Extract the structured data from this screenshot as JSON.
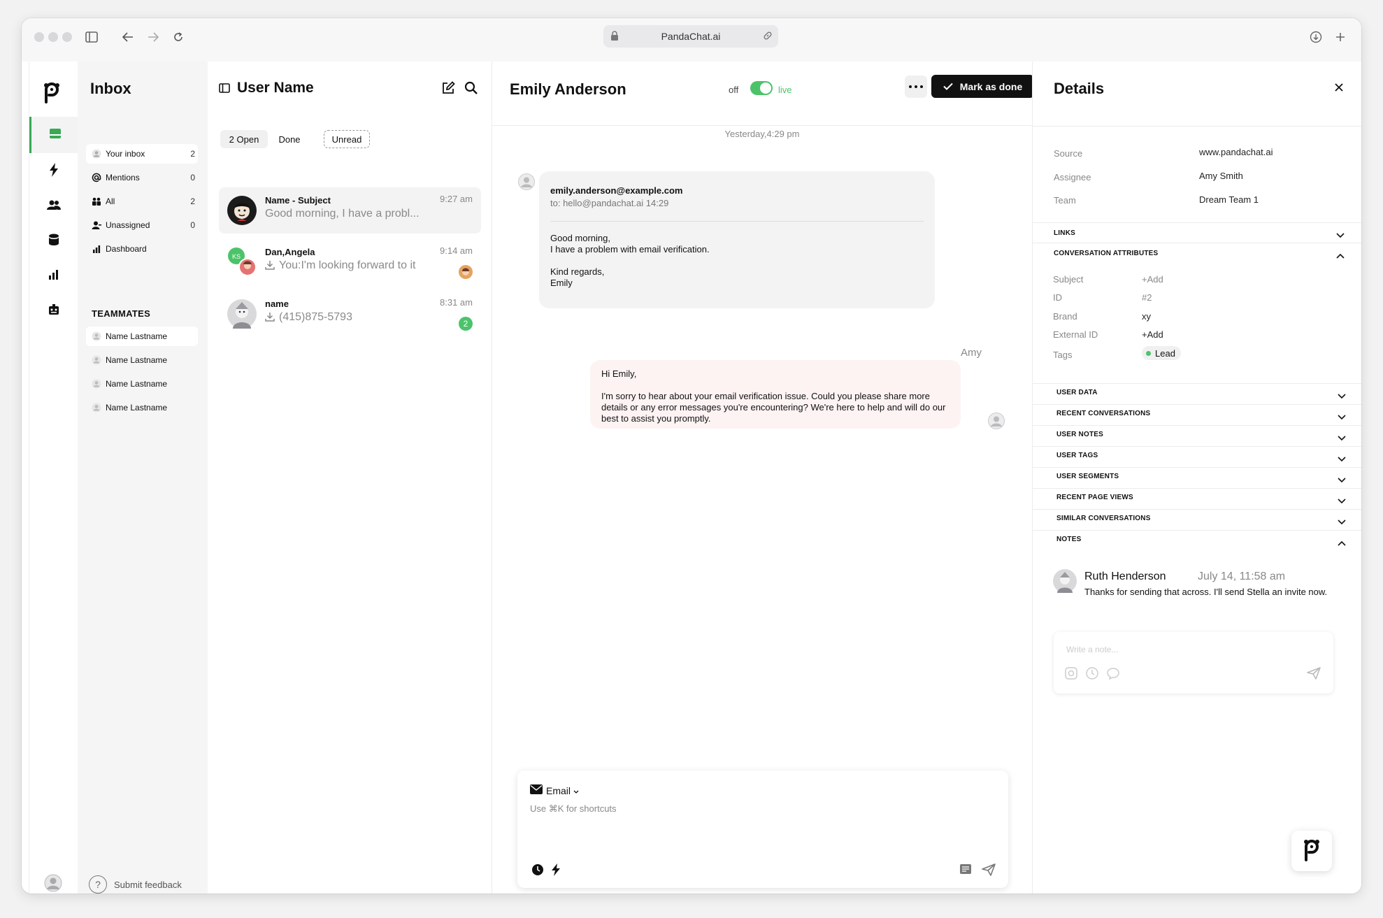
{
  "browser": {
    "url": "PandaChat.ai"
  },
  "sidebar_nav": {
    "title": "Inbox",
    "items": [
      {
        "label": "Your inbox",
        "count": "2",
        "icon": "person-icon"
      },
      {
        "label": "Mentions",
        "count": "0",
        "icon": "at-icon"
      },
      {
        "label": "All",
        "count": "2",
        "icon": "group-icon"
      },
      {
        "label": "Unassigned",
        "count": "0",
        "icon": "unassigned-icon"
      },
      {
        "label": "Dashboard",
        "count": "",
        "icon": "bar-chart-icon"
      }
    ],
    "teammates_heading": "TEAMMATES",
    "teammates": [
      "Name Lastname",
      "Name Lastname",
      "Name Lastname",
      "Name Lastname"
    ],
    "feedback": "Submit feedback"
  },
  "conversation_list": {
    "title": "User Name",
    "filters": {
      "open": "2 Open",
      "done": "Done",
      "unread": "Unread"
    },
    "items": [
      {
        "name": "Name - Subject",
        "preview": "Good morning, I have a probl...",
        "time": "9:27 am"
      },
      {
        "name": "Dan,Angela",
        "preview": "You:I'm looking forward to it",
        "time": "9:14 am",
        "initials": "KS"
      },
      {
        "name": "name",
        "preview": "(415)875-5793",
        "time": "8:31 am",
        "badge": "2"
      }
    ]
  },
  "chat": {
    "contact_name": "Emily Anderson",
    "toggle_off": "off",
    "toggle_on": "live",
    "mark_done": "Mark as done",
    "timestamp": "Yesterday,4:29 pm",
    "incoming": {
      "from": "emily.anderson@example.com",
      "to": "to: hello@pandachat.ai  14:29",
      "body": "Good morning,\nI have a problem with email verification.\n\nKind regards,\nEmily"
    },
    "outgoing": {
      "author": "Amy",
      "body": "Hi Emily,\n\nI'm sorry to hear about your email verification issue. Could you please share more details or any error messages you're encountering? We're here to help and will do our best to assist you promptly."
    },
    "composer": {
      "channel": "Email",
      "placeholder": "Use ⌘K for shortcuts"
    }
  },
  "details": {
    "title": "Details",
    "info": [
      {
        "key": "Source",
        "value": "www.pandachat.ai"
      },
      {
        "key": "Assignee",
        "value": "Amy Smith"
      },
      {
        "key": "Team",
        "value": "Dream Team 1"
      }
    ],
    "links_heading": "LINKS",
    "attributes_heading": "CONVERSATION ATTRIBUTES",
    "attributes": [
      {
        "key": "Subject",
        "value": "+Add"
      },
      {
        "key": "ID",
        "value": "#2"
      },
      {
        "key": "Brand",
        "value": "xy"
      },
      {
        "key": "External ID",
        "value": "+Add"
      }
    ],
    "tags_label": "Tags",
    "tag": "Lead",
    "sections": [
      "USER DATA",
      "RECENT CONVERSATIONS",
      "USER NOTES",
      "USER TAGS",
      "USER SEGMENTS",
      "RECENT PAGE VIEWS",
      "SIMILAR CONVERSATIONS"
    ],
    "notes_heading": "NOTES",
    "note": {
      "author": "Ruth Henderson",
      "date": "July 14, 11:58 am",
      "text": "Thanks for sending that across. I'll send Stella an invite now."
    },
    "note_placeholder": "Write a note..."
  },
  "colors": {
    "accent": "#4cc36a",
    "dark": "#111111"
  }
}
